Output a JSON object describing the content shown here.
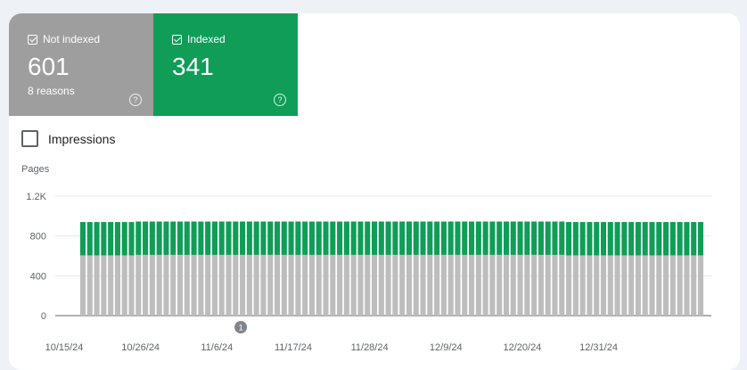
{
  "tiles": {
    "not_indexed": {
      "label": "Not indexed",
      "value": "601",
      "sub": "8 reasons",
      "color": "#9e9e9e"
    },
    "indexed": {
      "label": "Indexed",
      "value": "341",
      "color": "#0f9d58"
    }
  },
  "impressions": {
    "label": "Impressions",
    "checked": false
  },
  "chart_data": {
    "type": "bar",
    "stacked": true,
    "ylabel": "Pages",
    "ylim": [
      0,
      1200
    ],
    "y_ticks": [
      "0",
      "400",
      "800",
      "1.2K"
    ],
    "x_ticks": [
      "10/15/24",
      "10/26/24",
      "11/6/24",
      "11/17/24",
      "11/28/24",
      "12/9/24",
      "12/20/24",
      "12/31/24"
    ],
    "annotation": {
      "label": "1",
      "category_index": 23
    },
    "series": [
      {
        "name": "Not indexed",
        "color": "#bdbdbd",
        "values": [
          605,
          605,
          605,
          605,
          605,
          605,
          605,
          605,
          610,
          610,
          610,
          610,
          610,
          610,
          610,
          610,
          610,
          610,
          610,
          610,
          610,
          610,
          610,
          610,
          610,
          610,
          610,
          610,
          610,
          610,
          610,
          610,
          610,
          610,
          610,
          610,
          610,
          610,
          610,
          610,
          610,
          610,
          610,
          610,
          610,
          610,
          610,
          610,
          610,
          610,
          610,
          610,
          610,
          610,
          610,
          610,
          610,
          610,
          610,
          610,
          610,
          610,
          610,
          610,
          610,
          610,
          610,
          610,
          610,
          610,
          605,
          605,
          605,
          605,
          605,
          605,
          605,
          605,
          605,
          605,
          605,
          605,
          605,
          605,
          605,
          605,
          605,
          605,
          605,
          605
        ]
      },
      {
        "name": "Indexed",
        "color": "#0f9d58",
        "values": [
          335,
          335,
          335,
          335,
          335,
          335,
          335,
          335,
          335,
          335,
          335,
          335,
          335,
          335,
          335,
          335,
          335,
          335,
          335,
          335,
          335,
          335,
          335,
          335,
          335,
          335,
          335,
          335,
          335,
          335,
          335,
          335,
          335,
          335,
          335,
          335,
          335,
          335,
          335,
          335,
          335,
          335,
          335,
          335,
          335,
          335,
          335,
          335,
          335,
          335,
          335,
          335,
          335,
          335,
          335,
          335,
          335,
          335,
          335,
          335,
          335,
          335,
          335,
          335,
          335,
          335,
          335,
          335,
          335,
          335,
          335,
          335,
          335,
          335,
          335,
          335,
          335,
          335,
          335,
          335,
          335,
          335,
          335,
          335,
          335,
          335,
          335,
          335,
          335,
          335
        ]
      }
    ]
  }
}
